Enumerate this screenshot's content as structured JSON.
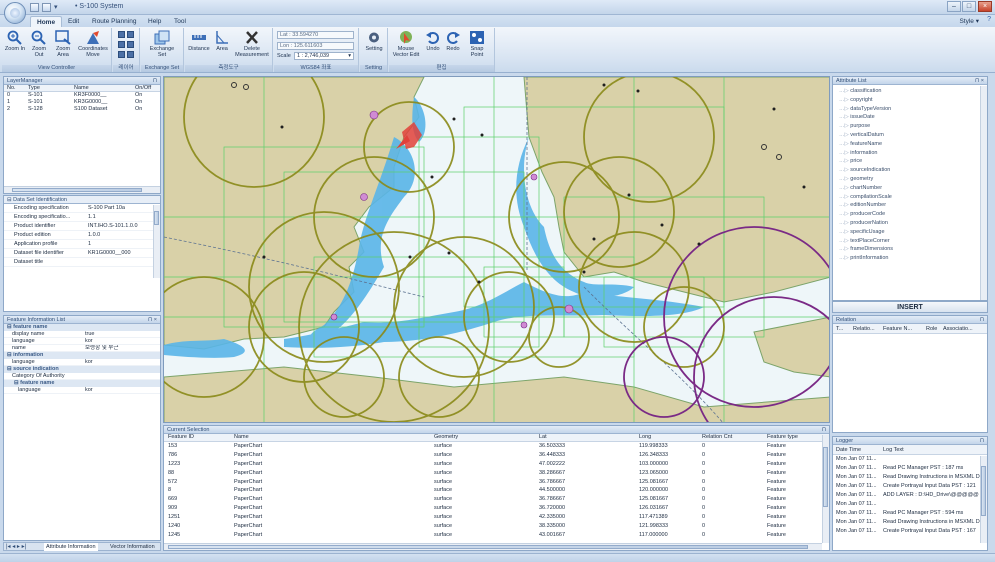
{
  "app": {
    "title": "S-100 System"
  },
  "tabs": [
    "Home",
    "Edit",
    "Route Planning",
    "Help",
    "Tool"
  ],
  "style_label": "Style",
  "ribbon": {
    "view_controller": {
      "label": "View Controller",
      "buttons": [
        "Zoom In",
        "Zoom Out",
        "Zoom Area",
        "Coordinates Move"
      ]
    },
    "layers_label": "레이어",
    "exchange": {
      "button": "Exchange Set",
      "label": "Exchange Set"
    },
    "measure": {
      "buttons": [
        "Distance",
        "Area",
        "Delete Measurement"
      ],
      "label": "측정도구"
    },
    "wgs84": {
      "lat": "Lat : 33.594270",
      "lon": "Lon : 125.611603",
      "scale": "1 : 2,746,039",
      "scale_prefix": "Scale",
      "label": "WGS84 좌표"
    },
    "setting": {
      "button": "Setting",
      "label": "Setting"
    },
    "edit": {
      "buttons": [
        "Mouse Vector Edit",
        "Undo",
        "Redo",
        "Snap Point"
      ],
      "label": "편집"
    }
  },
  "layer_manager": {
    "title": "LayerManager",
    "columns": [
      "No.",
      "Type",
      "Name",
      "On/Off"
    ],
    "rows": [
      [
        "0",
        "S-101",
        "KR3F0000__",
        "On"
      ],
      [
        "1",
        "S-101",
        "KR3G0000__",
        "On"
      ],
      [
        "2",
        "S-128",
        "S100 Dataset",
        "On"
      ]
    ]
  },
  "dataset_identification": {
    "title": "Data Set Identification",
    "rows": [
      [
        "Encoding specification",
        "S-100 Part 10a"
      ],
      [
        "Encoding specificatio...",
        "1.1"
      ],
      [
        "Product identifier",
        "INT.IHO.S-101.1.0.0"
      ],
      [
        "Product edition",
        "1.0.0"
      ],
      [
        "Application profile",
        "1"
      ],
      [
        "Dataset file identifier",
        "KR1G0000__000"
      ],
      [
        "Dataset title",
        ""
      ]
    ]
  },
  "feature_info": {
    "title": "Feature Information List",
    "rows": [
      {
        "kind": "section",
        "text": "feature name"
      },
      {
        "kind": "kv",
        "k": "display name",
        "v": "true"
      },
      {
        "kind": "kv",
        "k": "language",
        "v": "kor"
      },
      {
        "kind": "kv",
        "k": "name",
        "v": "보령항 및 부근"
      },
      {
        "kind": "section",
        "text": "information"
      },
      {
        "kind": "kv",
        "k": "language",
        "v": "kor"
      },
      {
        "kind": "section",
        "text": "source indication"
      },
      {
        "kind": "kv",
        "k": "Category Of Authority",
        "v": ""
      },
      {
        "kind": "subsection",
        "text": "feature name"
      },
      {
        "kind": "kv2",
        "k": "language",
        "v": "kor"
      }
    ]
  },
  "bottom_tabs": [
    "Attribute Information",
    "Vector Information"
  ],
  "attribute_list": {
    "title": "Attribute List",
    "items": [
      "classification",
      "copyright",
      "dataTypeVersion",
      "issueDate",
      "purpose",
      "verticalDatum",
      "featureName",
      "information",
      "price",
      "sourceIndication",
      "geometry",
      "chartNumber",
      "compilationScale",
      "editionNumber",
      "producerCode",
      "producerNation",
      "specificUsage",
      "textPlaceCorner",
      "frameDimensions",
      "printInformation"
    ],
    "insert_label": "INSERT"
  },
  "relation": {
    "title": "Relation",
    "columns": [
      "T...",
      "Relatio...",
      "Feature N...",
      "Role",
      "Associatio..."
    ]
  },
  "current_selection": {
    "title": "Current Selection",
    "columns": [
      "Feature ID",
      "Name",
      "Geometry",
      "Lat",
      "Long",
      "Relation Cnt",
      "Feature type"
    ],
    "rows": [
      [
        "153",
        "PaperChart",
        "surface",
        "36.503333",
        "119.998333",
        "0",
        "Feature"
      ],
      [
        "786",
        "PaperChart",
        "surface",
        "36.448333",
        "126.348333",
        "0",
        "Feature"
      ],
      [
        "1223",
        "PaperChart",
        "surface",
        "47.002222",
        "103.000000",
        "0",
        "Feature"
      ],
      [
        "88",
        "PaperChart",
        "surface",
        "38.286667",
        "123.065000",
        "0",
        "Feature"
      ],
      [
        "572",
        "PaperChart",
        "surface",
        "36.786667",
        "125.081667",
        "0",
        "Feature"
      ],
      [
        "8",
        "PaperChart",
        "surface",
        "44.500000",
        "120.000000",
        "0",
        "Feature"
      ],
      [
        "669",
        "PaperChart",
        "surface",
        "36.786667",
        "125.081667",
        "0",
        "Feature"
      ],
      [
        "909",
        "PaperChart",
        "surface",
        "36.720000",
        "126.031667",
        "0",
        "Feature"
      ],
      [
        "1251",
        "PaperChart",
        "surface",
        "42.335000",
        "117.471389",
        "0",
        "Feature"
      ],
      [
        "1240",
        "PaperChart",
        "surface",
        "38.335000",
        "121.998333",
        "0",
        "Feature"
      ],
      [
        "1245",
        "PaperChart",
        "surface",
        "43.001667",
        "117.000000",
        "0",
        "Feature"
      ]
    ]
  },
  "logger": {
    "title": "Logger",
    "columns": [
      "Date Time",
      "Log Text"
    ],
    "rows": [
      [
        "Mon Jan 07 11...",
        ""
      ],
      [
        "Mon Jan 07 11...",
        "Read PC Manager PST : 187 ms"
      ],
      [
        "Mon Jan 07 11...",
        "Read Drawing Instructions in MSXML D"
      ],
      [
        "Mon Jan 07 11...",
        "Create Portrayal Input Data PST : 121"
      ],
      [
        "Mon Jan 07 11...",
        "ADD LAYER : D:\\HD_Drive\\@@@@@"
      ],
      [
        "Mon Jan 07 11...",
        ""
      ],
      [
        "Mon Jan 07 11...",
        "Read PC Manager PST : 594 ms"
      ],
      [
        "Mon Jan 07 11...",
        "Read Drawing Instructions in MSXML D"
      ],
      [
        "Mon Jan 07 11...",
        "Create Portrayal Input Data PST : 167"
      ]
    ]
  },
  "colors": {
    "land": "#d9d1a8",
    "water_shallow": "#59b5e8",
    "water_deep": "#eef6f9",
    "grid": "#5bd16a",
    "circles": "#8a8a18",
    "purple": "#7a2a86",
    "accent": "#c0392b"
  }
}
